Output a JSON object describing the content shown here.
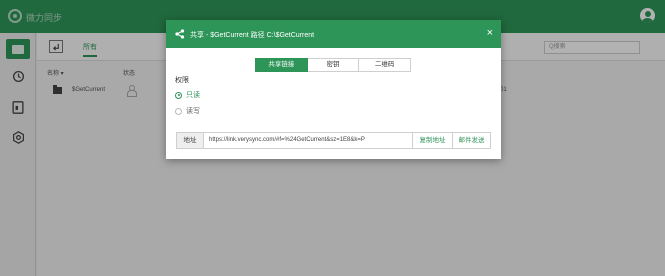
{
  "app": {
    "title": "微力同步"
  },
  "toolbar": {
    "tab_all": "所有",
    "search_placeholder": "Q搜索"
  },
  "columns": {
    "name": "名称 ▾",
    "status": "状态"
  },
  "files": [
    {
      "name": "$GetCurrent",
      "date": "01"
    }
  ],
  "dialog": {
    "title": "共享 - $GetCurrent 路径 C:\\$GetCurrent",
    "close": "×",
    "tabs": [
      {
        "label": "共享链接",
        "active": true
      },
      {
        "label": "密钥",
        "active": false
      },
      {
        "label": "二维码",
        "active": false
      }
    ],
    "permission_label": "权限",
    "options": [
      {
        "label": "只读",
        "checked": true
      },
      {
        "label": "读写",
        "checked": false
      }
    ],
    "address_label": "地址",
    "address_value": "https://link.verysync.com/#f=%24GetCurrent&sz=1E8&k=P",
    "copy_button": "复制地址",
    "email_button": "邮件发送"
  },
  "colors": {
    "brand": "#2e9558"
  },
  "icons": {
    "logo": "sync-logo-icon",
    "user": "user-avatar-icon",
    "sidebar": [
      "folder-icon",
      "history-icon",
      "device-icon",
      "settings-icon"
    ]
  }
}
